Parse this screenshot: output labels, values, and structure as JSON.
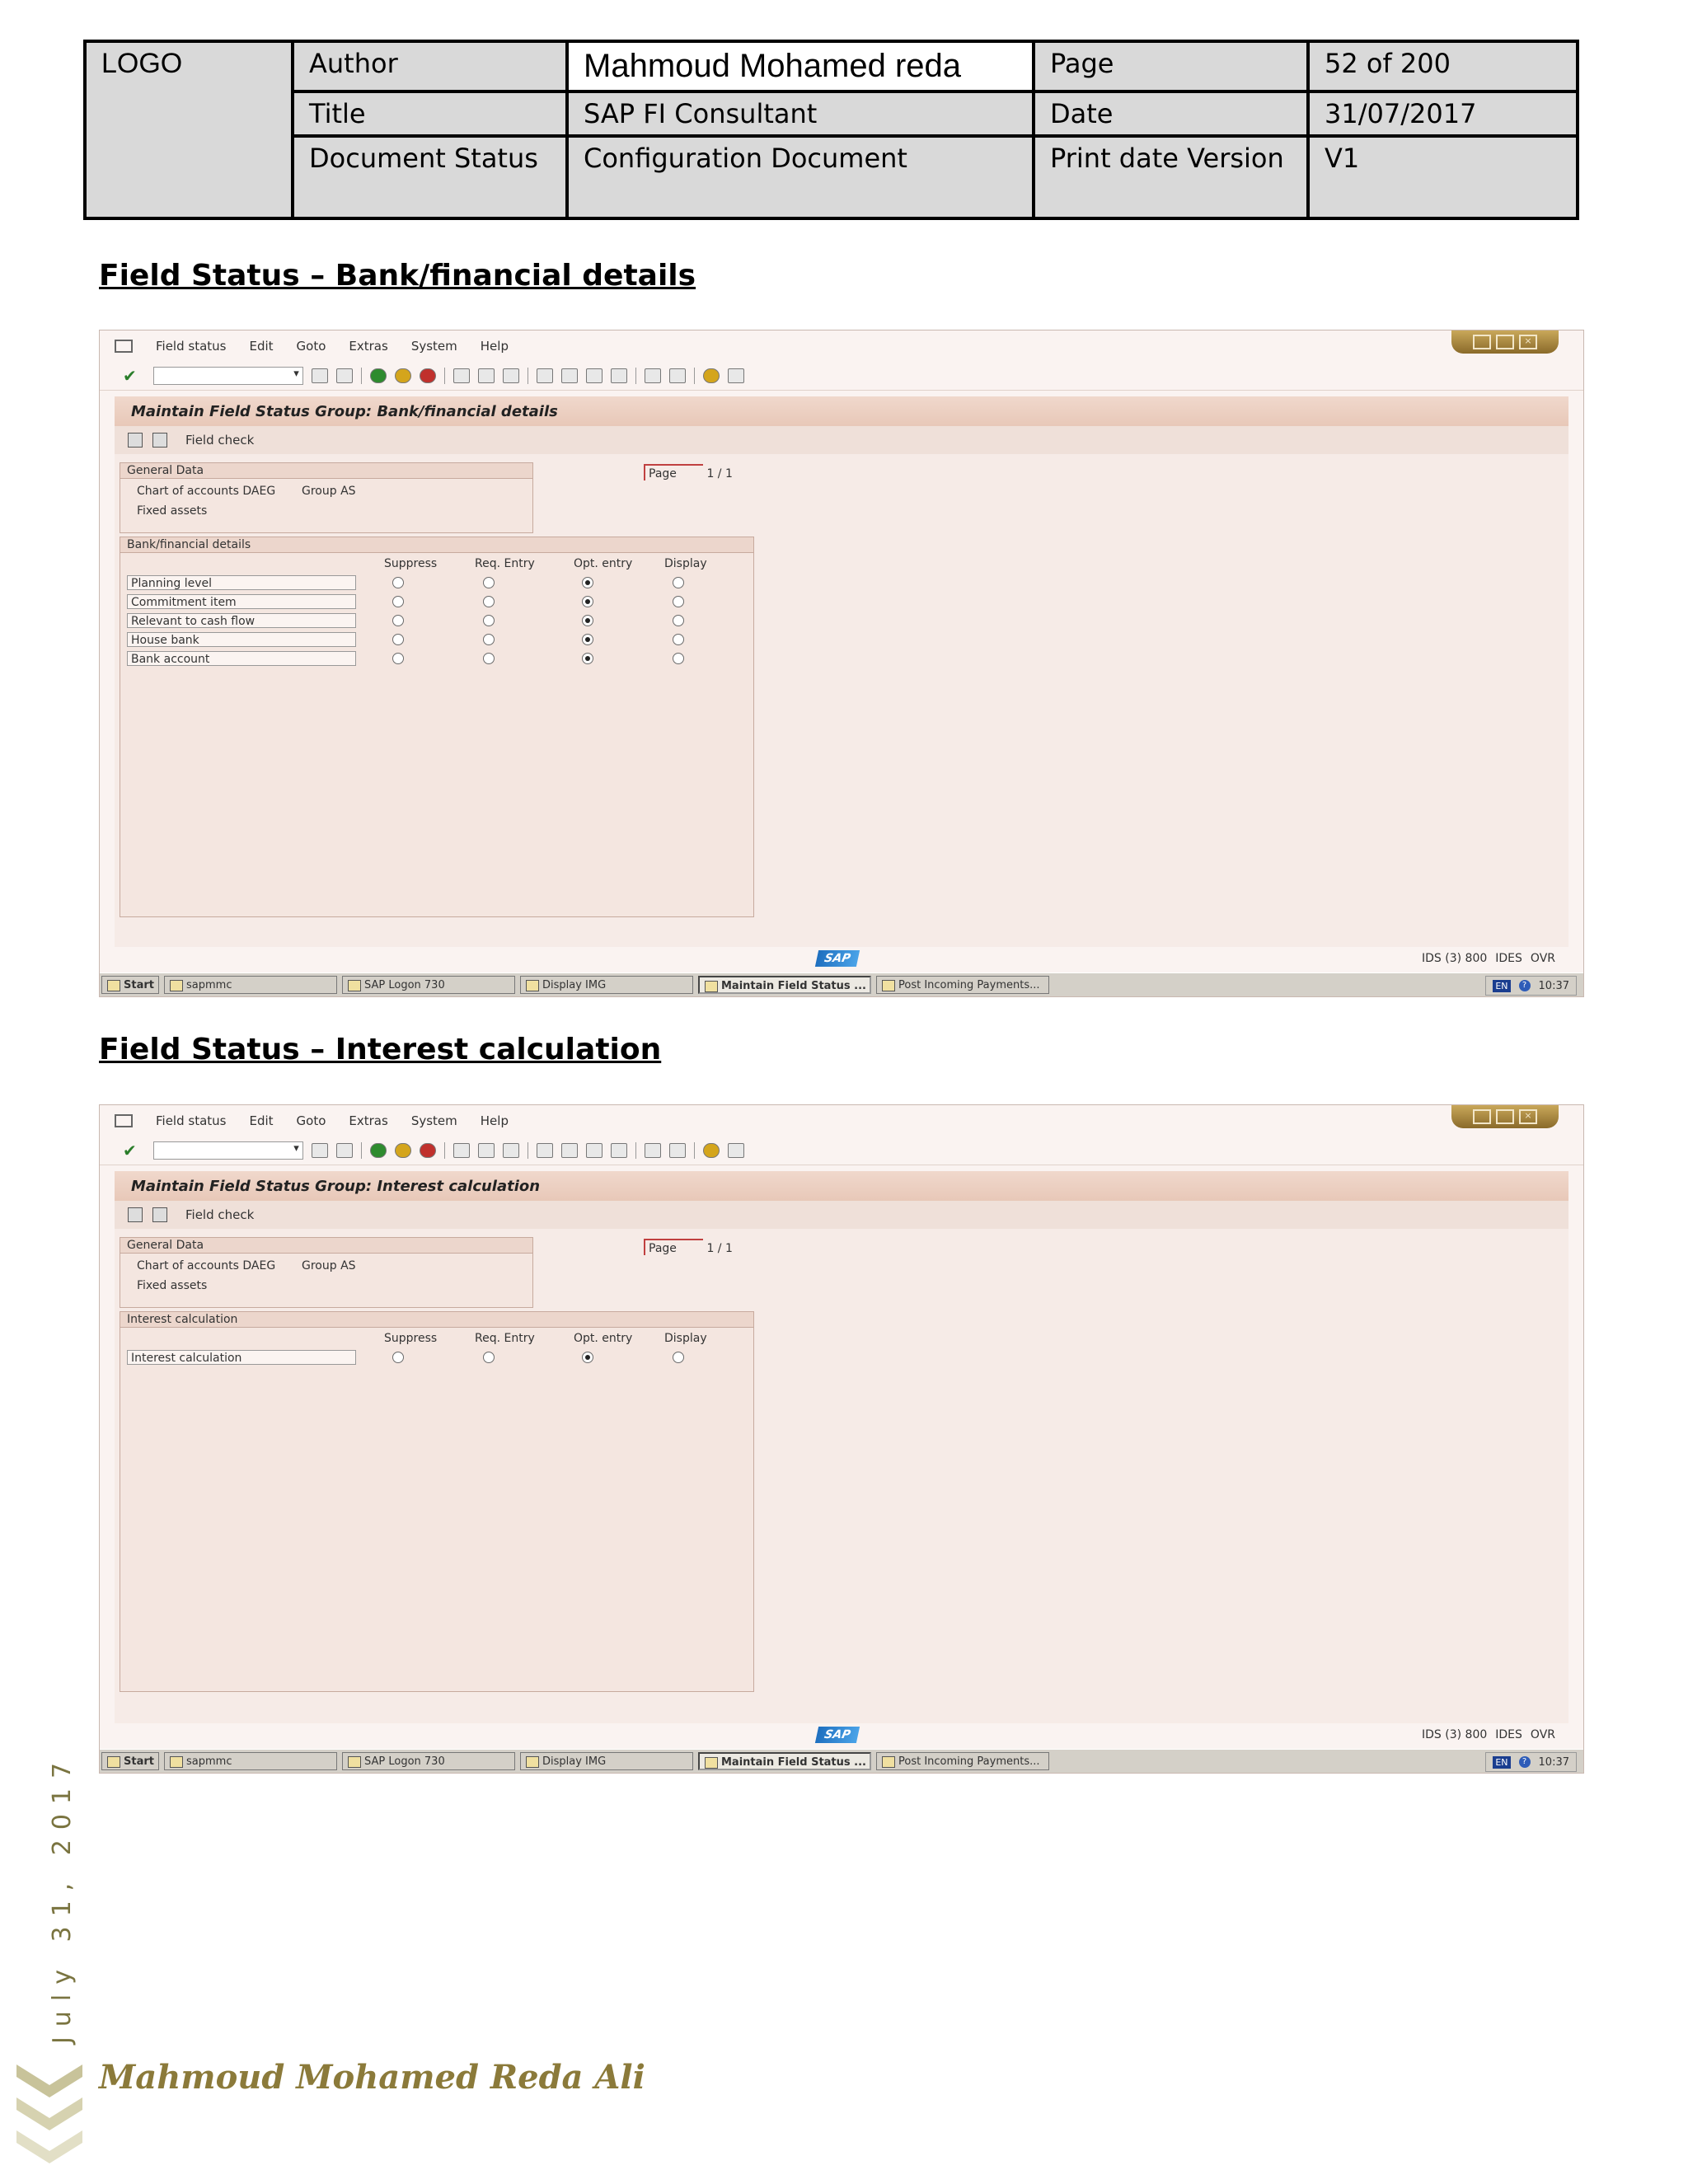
{
  "header": {
    "logo": "LOGO",
    "author_label": "Author",
    "author_value": "Mahmoud Mohamed reda",
    "page_label": "Page",
    "page_value": "52 of 200",
    "title_label": "Title",
    "title_value": "SAP FI Consultant",
    "date_label": "Date",
    "date_value": "31/07/2017",
    "status_label": "Document Status",
    "status_value": "Configuration Document",
    "version_label": "Print date Version",
    "version_value": "V1"
  },
  "sections": [
    {
      "heading": "Field Status – Bank/financial details",
      "screen": {
        "menu": [
          "Field status",
          "Edit",
          "Goto",
          "Extras",
          "System",
          "Help"
        ],
        "title": "Maintain Field Status Group: Bank/financial details",
        "appbar_label": "Field check",
        "general_title": "General Data",
        "chart_line": "Chart of accounts DAEG",
        "group_line": "Group AS",
        "fixed_line": "Fixed assets",
        "page_label": "Page",
        "page_value": "1 / 1",
        "group_box_title": "Bank/financial details",
        "columns": [
          "Suppress",
          "Req. Entry",
          "Opt. entry",
          "Display"
        ],
        "fields": [
          {
            "label": "Planning level",
            "selected": 2
          },
          {
            "label": "Commitment item",
            "selected": 2
          },
          {
            "label": "Relevant to cash flow",
            "selected": 2
          },
          {
            "label": "House bank",
            "selected": 2
          },
          {
            "label": "Bank account",
            "selected": 2
          }
        ],
        "sysinfo": [
          "IDS (3) 800",
          "IDES",
          "OVR"
        ],
        "taskbar": [
          "Start",
          "sapmmc",
          "SAP Logon 730",
          "Display IMG",
          "Maintain Field Status ...",
          "Post Incoming Payments..."
        ],
        "lang": "EN",
        "time": "10:37"
      }
    },
    {
      "heading": "Field Status – Interest calculation",
      "screen": {
        "menu": [
          "Field status",
          "Edit",
          "Goto",
          "Extras",
          "System",
          "Help"
        ],
        "title": "Maintain Field Status Group: Interest calculation",
        "appbar_label": "Field check",
        "general_title": "General Data",
        "chart_line": "Chart of accounts DAEG",
        "group_line": "Group AS",
        "fixed_line": "Fixed assets",
        "page_label": "Page",
        "page_value": "1 / 1",
        "group_box_title": "Interest calculation",
        "columns": [
          "Suppress",
          "Req. Entry",
          "Opt. entry",
          "Display"
        ],
        "fields": [
          {
            "label": "Interest calculation",
            "selected": 2
          }
        ],
        "sysinfo": [
          "IDS (3) 800",
          "IDES",
          "OVR"
        ],
        "taskbar": [
          "Start",
          "sapmmc",
          "SAP Logon 730",
          "Display IMG",
          "Maintain Field Status ...",
          "Post Incoming Payments..."
        ],
        "lang": "EN",
        "time": "10:37"
      }
    }
  ],
  "side": {
    "date_vertical": "July 31, 2017",
    "footer_name": "Mahmoud Mohamed Reda Ali",
    "chevron_color": "#c8c39a"
  }
}
